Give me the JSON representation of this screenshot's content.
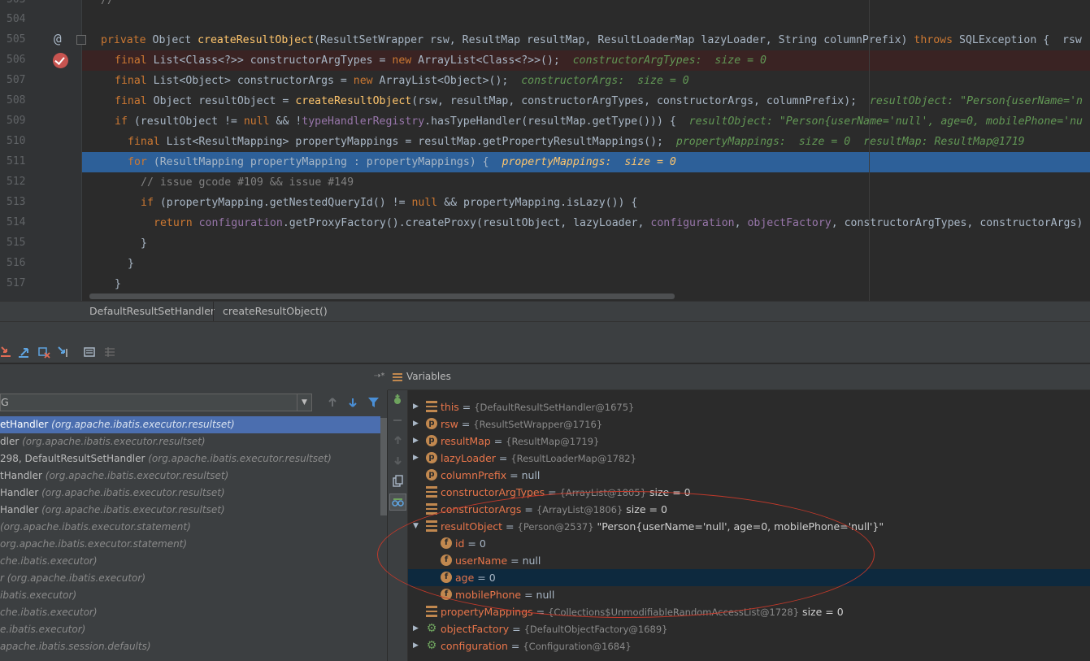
{
  "editor": {
    "lines": [
      {
        "num": "503",
        "text": "//"
      },
      {
        "num": "504",
        "text": ""
      },
      {
        "num": "505",
        "text": "private Object createResultObject(ResultSetWrapper rsw, ResultMap resultMap, ResultLoaderMap lazyLoader, String columnPrefix) throws SQLException {  rsw"
      },
      {
        "num": "506",
        "text": "final List<Class<?>> constructorArgTypes = new ArrayList<Class<?>>();  constructorArgTypes:  size = 0"
      },
      {
        "num": "507",
        "text": "final List<Object> constructorArgs = new ArrayList<Object>();  constructorArgs:  size = 0"
      },
      {
        "num": "508",
        "text": "final Object resultObject = createResultObject(rsw, resultMap, constructorArgTypes, constructorArgs, columnPrefix);  resultObject: \"Person{userName='n"
      },
      {
        "num": "509",
        "text": "if (resultObject != null && !typeHandlerRegistry.hasTypeHandler(resultMap.getType())) {  resultObject: \"Person{userName='null', age=0, mobilePhone='nu"
      },
      {
        "num": "510",
        "text": "final List<ResultMapping> propertyMappings = resultMap.getPropertyResultMappings();  propertyMappings:  size = 0  resultMap: ResultMap@1719"
      },
      {
        "num": "511",
        "text": "for (ResultMapping propertyMapping : propertyMappings) {  propertyMappings:  size = 0"
      },
      {
        "num": "512",
        "text": "// issue gcode #109 && issue #149"
      },
      {
        "num": "513",
        "text": "if (propertyMapping.getNestedQueryId() != null && propertyMapping.isLazy()) {"
      },
      {
        "num": "514",
        "text": "return configuration.getProxyFactory().createProxy(resultObject, lazyLoader, configuration, objectFactory, constructorArgTypes, constructorArgs)"
      },
      {
        "num": "515",
        "text": "}"
      },
      {
        "num": "516",
        "text": "}"
      },
      {
        "num": "517",
        "text": "}"
      }
    ]
  },
  "breadcrumb": {
    "items": [
      "DefaultResultSetHandler",
      "createResultObject()"
    ]
  },
  "frames": {
    "thread_value": "G",
    "items": [
      {
        "name": "etHandler",
        "pkg": "(org.apache.ibatis.executor.resultset)",
        "selected": true
      },
      {
        "name": "dler",
        "pkg": "(org.apache.ibatis.executor.resultset)"
      },
      {
        "name": "298, DefaultResultSetHandler",
        "pkg": "(org.apache.ibatis.executor.resultset)"
      },
      {
        "name": "tHandler",
        "pkg": "(org.apache.ibatis.executor.resultset)"
      },
      {
        "name": "Handler",
        "pkg": "(org.apache.ibatis.executor.resultset)"
      },
      {
        "name": "Handler",
        "pkg": "(org.apache.ibatis.executor.resultset)"
      },
      {
        "name": "",
        "pkg": "(org.apache.ibatis.executor.statement)",
        "lib": true
      },
      {
        "name": "",
        "pkg": "org.apache.ibatis.executor.statement)",
        "lib": true
      },
      {
        "name": "",
        "pkg": "che.ibatis.executor)",
        "lib": true
      },
      {
        "name": "r",
        "pkg": "(org.apache.ibatis.executor)",
        "lib": true
      },
      {
        "name": "",
        "pkg": "ibatis.executor)",
        "lib": true
      },
      {
        "name": "",
        "pkg": "che.ibatis.executor)",
        "lib": true
      },
      {
        "name": "",
        "pkg": "e.ibatis.executor)",
        "lib": true
      },
      {
        "name": "",
        "pkg": "apache.ibatis.session.defaults)",
        "lib": true
      }
    ]
  },
  "variables": {
    "title": "Variables",
    "rows": [
      {
        "name": "this",
        "eq": " = ",
        "type": "{DefaultResultSetHandler@1675}",
        "extra": "",
        "icon": "list",
        "expandable": true
      },
      {
        "name": "rsw",
        "eq": " = ",
        "type": "{ResultSetWrapper@1716}",
        "extra": "",
        "icon": "p",
        "expandable": true
      },
      {
        "name": "resultMap",
        "eq": " = ",
        "type": "{ResultMap@1719}",
        "extra": "",
        "icon": "p",
        "expandable": true
      },
      {
        "name": "lazyLoader",
        "eq": " = ",
        "type": "{ResultLoaderMap@1782}",
        "extra": "",
        "icon": "p",
        "expandable": true
      },
      {
        "name": "columnPrefix",
        "eq": " = null",
        "type": "",
        "extra": "",
        "icon": "p",
        "expandable": false
      },
      {
        "name": "constructorArgTypes",
        "eq": " = ",
        "type": "{ArrayList@1805}",
        "extra": "  size = 0",
        "icon": "list",
        "expandable": false
      },
      {
        "name": "constructorArgs",
        "eq": " = ",
        "type": "{ArrayList@1806}",
        "extra": "  size = 0",
        "icon": "list",
        "expandable": false
      },
      {
        "name": "resultObject",
        "eq": " = ",
        "type": "{Person@2537}",
        "extra": " \"Person{userName='null', age=0, mobilePhone='null'}\"",
        "icon": "list",
        "expandable": true,
        "expanded": true
      },
      {
        "name": "id",
        "eq": " = 0",
        "type": "",
        "extra": "",
        "icon": "f",
        "child": true
      },
      {
        "name": "userName",
        "eq": " = null",
        "type": "",
        "extra": "",
        "icon": "f",
        "child": true
      },
      {
        "name": "age",
        "eq": " = 0",
        "type": "",
        "extra": "",
        "icon": "f",
        "child": true,
        "selected": true
      },
      {
        "name": "mobilePhone",
        "eq": " = null",
        "type": "",
        "extra": "",
        "icon": "f",
        "child": true
      },
      {
        "name": "propertyMappings",
        "eq": " = ",
        "type": "{Collections$UnmodifiableRandomAccessList@1728}",
        "extra": "  size = 0",
        "icon": "list",
        "expandable": false
      },
      {
        "name": "objectFactory",
        "eq": " = ",
        "type": "{DefaultObjectFactory@1689}",
        "extra": "",
        "icon": "gear",
        "expandable": true
      },
      {
        "name": "configuration",
        "eq": " = ",
        "type": "{Configuration@1684}",
        "extra": "",
        "icon": "gear",
        "expandable": true
      }
    ]
  },
  "colors": {
    "selection_blue": "#2d6099",
    "breakpoint_red": "#c75450",
    "annotation_red": "#c0392b"
  }
}
